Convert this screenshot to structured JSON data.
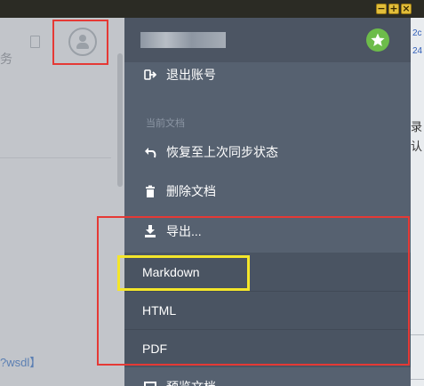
{
  "window_controls": [
    "−",
    "+",
    "×"
  ],
  "left_panel": {
    "partial_char": "务",
    "link_fragment": "?wsdl】"
  },
  "right_strip": {
    "link_fragments": [
      "2c",
      "24"
    ],
    "text_fragments": [
      "录",
      "认"
    ]
  },
  "menu": {
    "logout_label": "退出账号",
    "section_label": "当前文档",
    "restore_label": "恢复至上次同步状态",
    "delete_label": "删除文档",
    "export_label": "导出...",
    "export_options": [
      "Markdown",
      "HTML",
      "PDF"
    ],
    "preview_label": "预览文档"
  },
  "colors": {
    "menu_bg": "#566170",
    "submenu_bg": "#4a5462",
    "highlight_red": "#e53935",
    "highlight_yellow": "#f4e62a",
    "badge_green": "#6dbc4a"
  }
}
